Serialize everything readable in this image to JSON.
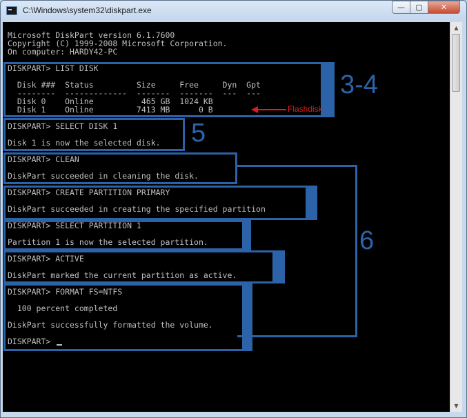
{
  "window": {
    "title": "C:\\Windows\\system32\\diskpart.exe",
    "controls": {
      "minimize": "—",
      "maximize": "▢",
      "close": "✕"
    }
  },
  "console": {
    "lines": [
      "Microsoft DiskPart version 6.1.7600",
      "Copyright (C) 1999-2008 Microsoft Corporation.",
      "On computer: HARDY42-PC",
      "DISKPART> LIST DISK",
      "  Disk ###  Status         Size     Free     Dyn  Gpt",
      "  --------  -------------  -------  -------  ---  ---",
      "  Disk 0    Online          465 GB  1024 KB",
      "  Disk 1    Online         7413 MB      0 B",
      "DISKPART> SELECT DISK 1",
      "Disk 1 is now the selected disk.",
      "DISKPART> CLEAN",
      "DiskPart succeeded in cleaning the disk.",
      "DISKPART> CREATE PARTITION PRIMARY",
      "DiskPart succeeded in creating the specified partition",
      "DISKPART> SELECT PARTITION 1",
      "Partition 1 is now the selected partition.",
      "DISKPART> ACTIVE",
      "DiskPart marked the current partition as active.",
      "DISKPART> FORMAT FS=NTFS",
      "  100 percent completed",
      "DiskPart successfully formatted the volume.",
      "DISKPART> "
    ]
  },
  "annotations": {
    "step_3_4": "3-4",
    "step_5": "5",
    "step_6": "6",
    "flashdisk_label": "Flashdisk",
    "accent_color": "#2c63a8",
    "arrow_color": "#e01b1b"
  }
}
